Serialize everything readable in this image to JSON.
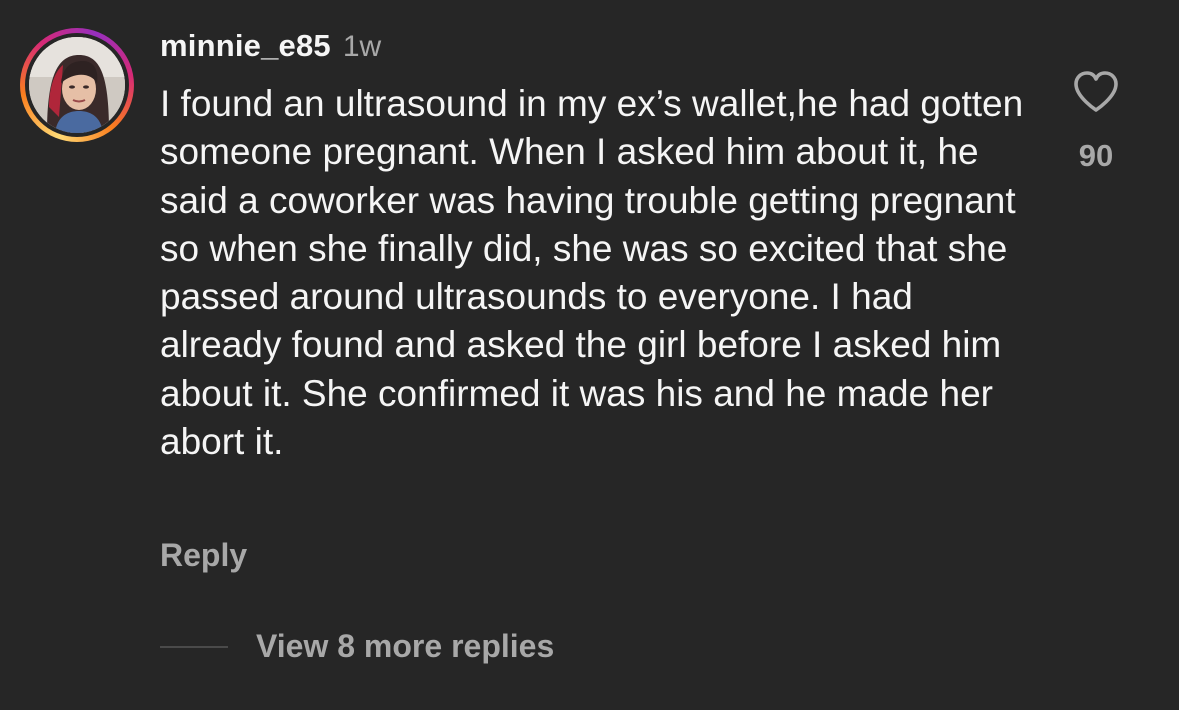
{
  "comment": {
    "username": "minnie_e85",
    "time_ago": "1w",
    "text": "I found an ultrasound in my ex’s wallet,he had gotten someone pregnant. When I asked him about it, he said a coworker was having trouble getting pregnant so when she finally did, she was so excited that she passed around ultrasounds to everyone. I had already found and asked the girl before I asked him about it. She confirmed it was his and he made her abort it.",
    "reply_label": "Reply",
    "view_replies_label": "View 8 more replies",
    "like_count": "90",
    "like_icon": "heart-outline-icon",
    "avatar_icon": "user-avatar"
  },
  "colors": {
    "background": "#262626",
    "primary_text": "#f5f5f5",
    "secondary_text": "#a8a8a8",
    "story_ring": [
      "#feda75",
      "#fa7e1e",
      "#d62976",
      "#962fbf"
    ]
  }
}
